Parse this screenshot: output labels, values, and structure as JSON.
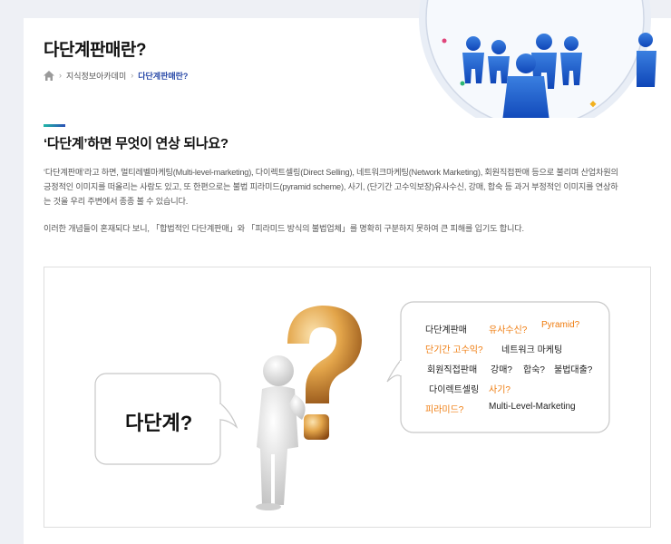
{
  "page": {
    "title": "다단계판매란?",
    "breadcrumb": [
      "지식정보아카데미",
      "다단계판매란?"
    ]
  },
  "section": {
    "heading": "‘다단계’하면 무엇이 연상 되나요?",
    "paragraph1": "‘다단계판매’라고 하면, 멀티레벨마케팅(Multi-level-marketing), 다이렉트셀링(Direct Selling), 네트워크마케팅(Network Marketing), 회원직접판매 등으로 불리며 산업차원의 긍정적인 이미지를 떠올리는 사람도 있고, 또 한편으로는 불법 피라미드(pyramid scheme), 사기, (단기간 고수익보장)유사수신, 강매, 합숙 등 과거 부정적인 이미지를 연상하는 것을 우리 주변에서 종종 볼 수 있습니다.",
    "paragraph2": "이러한 개념들이 혼재되다 보니, 「합법적인 다단계판매」와 「피라미드 방식의 불법업체」를 명확히 구분하지 못하여 큰 피해를 입기도 합니다."
  },
  "figure": {
    "left_bubble": "다단계?",
    "terms": [
      {
        "text": "다단계판매",
        "color": "dark"
      },
      {
        "text": "유사수신?",
        "color": "orange"
      },
      {
        "text": "Pyramid?",
        "color": "orange"
      },
      {
        "text": "단기간 고수익?",
        "color": "orange"
      },
      {
        "text": "네트워크 마케팅",
        "color": "dark"
      },
      {
        "text": "회원직접판매",
        "color": "dark"
      },
      {
        "text": "강매?",
        "color": "dark"
      },
      {
        "text": "합숙?",
        "color": "dark"
      },
      {
        "text": "불법대출?",
        "color": "dark"
      },
      {
        "text": "다이렉트셀링",
        "color": "dark"
      },
      {
        "text": "사기?",
        "color": "orange"
      },
      {
        "text": "피라미드?",
        "color": "orange"
      },
      {
        "text": "Multi-Level-Marketing",
        "color": "dark"
      }
    ]
  },
  "colors": {
    "accent_blue": "#2a4aa8",
    "accent_orange": "#ef7c0f",
    "teal": "#1fb7a6"
  }
}
